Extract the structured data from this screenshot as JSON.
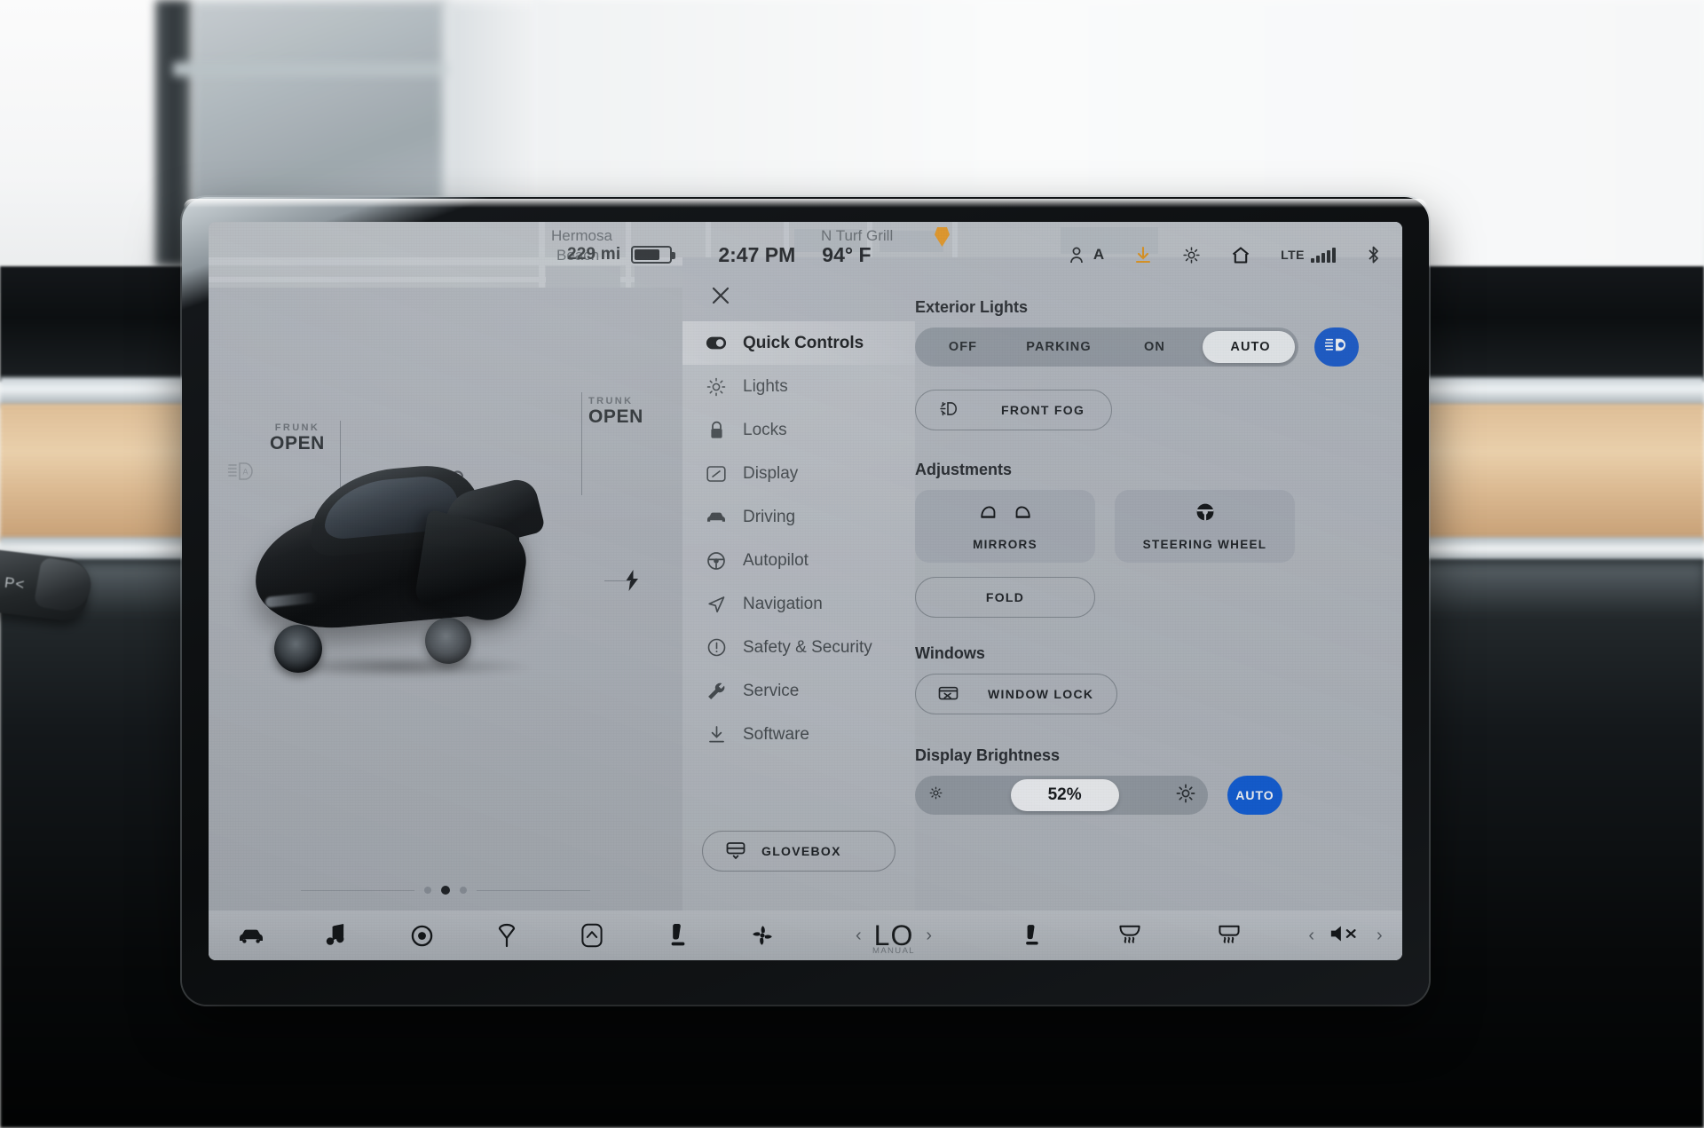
{
  "vehicle_ui": {
    "status_bar": {
      "range": "229 mi",
      "battery_level_pct": 72,
      "time": "2:47 PM",
      "temperature": "94° F",
      "profile_letter": "A",
      "network": "LTE",
      "signal_bars": 4,
      "icons": [
        "profile-icon",
        "download-icon",
        "sentry-icon",
        "home-icon",
        "signal-icon",
        "bluetooth-icon"
      ]
    },
    "map": {
      "labels": [
        "Hermosa Beach",
        "N Turf Grill"
      ],
      "pin": "poi-pin"
    },
    "car_view": {
      "frunk": {
        "caption": "FRUNK",
        "state": "OPEN"
      },
      "trunk": {
        "caption": "TRUNK",
        "state": "OPEN"
      },
      "lock_state": "unlocked",
      "headlight_indicator": "auto-headlight-icon",
      "charge_port_indicator": "charge-bolt-icon",
      "page_dots": {
        "count": 3,
        "active_index": 1
      }
    },
    "panel": {
      "close_label": "✕",
      "menu": [
        {
          "label": "Quick Controls",
          "icon": "quick-controls-icon",
          "active": true
        },
        {
          "label": "Lights",
          "icon": "lights-icon",
          "active": false
        },
        {
          "label": "Locks",
          "icon": "lock-icon",
          "active": false
        },
        {
          "label": "Display",
          "icon": "display-icon",
          "active": false
        },
        {
          "label": "Driving",
          "icon": "car-icon",
          "active": false
        },
        {
          "label": "Autopilot",
          "icon": "steering-wheel-icon",
          "active": false
        },
        {
          "label": "Navigation",
          "icon": "navigation-arrow-icon",
          "active": false
        },
        {
          "label": "Safety & Security",
          "icon": "alert-circle-icon",
          "active": false
        },
        {
          "label": "Service",
          "icon": "wrench-icon",
          "active": false
        },
        {
          "label": "Software",
          "icon": "download-icon",
          "active": false
        }
      ],
      "glovebox_button": {
        "label": "GLOVEBOX",
        "icon": "glovebox-icon"
      },
      "sections": {
        "exterior_lights": {
          "title": "Exterior Lights",
          "options": [
            "OFF",
            "PARKING",
            "ON",
            "AUTO"
          ],
          "selected": "AUTO",
          "highbeam_toggle": {
            "icon": "auto-highbeam-icon",
            "active": true,
            "color": "#1d5fd0"
          },
          "front_fog": {
            "label": "FRONT FOG",
            "icon": "fog-light-icon",
            "active": false
          }
        },
        "adjustments": {
          "title": "Adjustments",
          "tiles": [
            {
              "label": "MIRRORS",
              "icon": "mirrors-icon"
            },
            {
              "label": "STEERING WHEEL",
              "icon": "steering-wheel-icon"
            }
          ],
          "fold_button": {
            "label": "FOLD"
          }
        },
        "windows": {
          "title": "Windows",
          "window_lock": {
            "label": "WINDOW LOCK",
            "icon": "window-lock-icon",
            "active": false
          }
        },
        "display_brightness": {
          "title": "Display Brightness",
          "value": "52%",
          "value_pct": 52,
          "low_icon": "brightness-low-icon",
          "high_icon": "brightness-high-icon",
          "auto_button": {
            "label": "AUTO",
            "active": true,
            "color": "#1561d8"
          }
        }
      }
    },
    "bottom_bar": {
      "left_icons": [
        "car-icon",
        "media-note-icon",
        "camera-icon",
        "wiper-icon",
        "trunk-icon",
        "seat-icon",
        "fan-icon"
      ],
      "climate": {
        "value": "LO",
        "mode_label": "MANUAL",
        "prev": "‹",
        "next": "›"
      },
      "right_icons": [
        "seat-heater-icon",
        "rear-defrost-icon",
        "front-defrost-icon"
      ],
      "volume": {
        "state": "muted",
        "icon": "volume-mute-icon",
        "prev": "‹",
        "next": "›"
      }
    }
  },
  "environment": {
    "stalk_label": "P<"
  }
}
